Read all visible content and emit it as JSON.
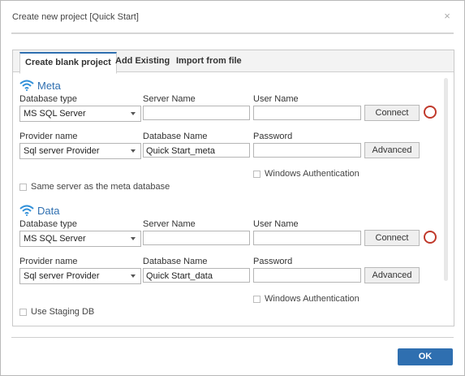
{
  "window": {
    "title": "Create new project [Quick Start]",
    "close_glyph": "×"
  },
  "tabs": [
    {
      "label": "Create blank project",
      "active": true
    },
    {
      "label": "Add Existing",
      "active": false
    },
    {
      "label": "Import from file",
      "active": false
    }
  ],
  "meta": {
    "title": "Meta",
    "icon": "wifi-icon",
    "database_type_label": "Database type",
    "database_type_value": "MS SQL Server",
    "server_name_label": "Server Name",
    "server_name_value": "",
    "user_name_label": "User Name",
    "user_name_value": "",
    "connect_label": "Connect",
    "provider_name_label": "Provider name",
    "provider_value": "Sql server Provider",
    "database_name_label": "Database Name",
    "database_name_value": "Quick Start_meta",
    "password_label": "Password",
    "password_value": "",
    "advanced_label": "Advanced",
    "windows_auth_label": "Windows Authentication",
    "same_server_label": "Same server as the meta database"
  },
  "data": {
    "title": "Data",
    "icon": "wifi-icon",
    "database_type_label": "Database type",
    "database_type_value": "MS SQL Server",
    "server_name_label": "Server Name",
    "server_name_value": "",
    "user_name_label": "User Name",
    "user_name_value": "",
    "connect_label": "Connect",
    "provider_name_label": "Provider name",
    "provider_value": "Sql server Provider",
    "database_name_label": "Database Name",
    "database_name_value": "Quick Start_data",
    "password_label": "Password",
    "password_value": "",
    "advanced_label": "Advanced",
    "windows_auth_label": "Windows Authentication",
    "use_staging_label": "Use Staging DB"
  },
  "footer": {
    "ok_label": "OK"
  },
  "colors": {
    "accent": "#2f6fb0",
    "status_ring": "#c0392b"
  }
}
